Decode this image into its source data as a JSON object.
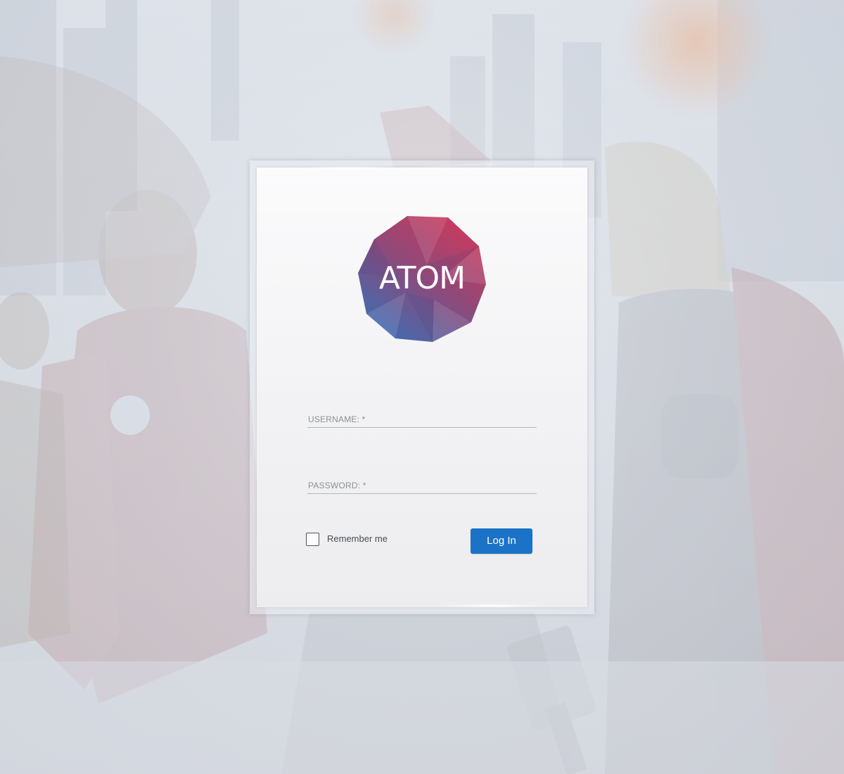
{
  "app": {
    "logo_text": "ATOM"
  },
  "form": {
    "username_label": "USERNAME: *",
    "password_label": "PASSWORD: *",
    "username_value": "",
    "password_value": "",
    "remember_label": "Remember me",
    "remember_checked": false,
    "login_label": "Log In"
  },
  "colors": {
    "button_primary": "#1a73c7",
    "logo_gradient_start": "#c93a5e",
    "logo_gradient_end": "#3f6cb0",
    "card_background": "#f3f3f5"
  }
}
